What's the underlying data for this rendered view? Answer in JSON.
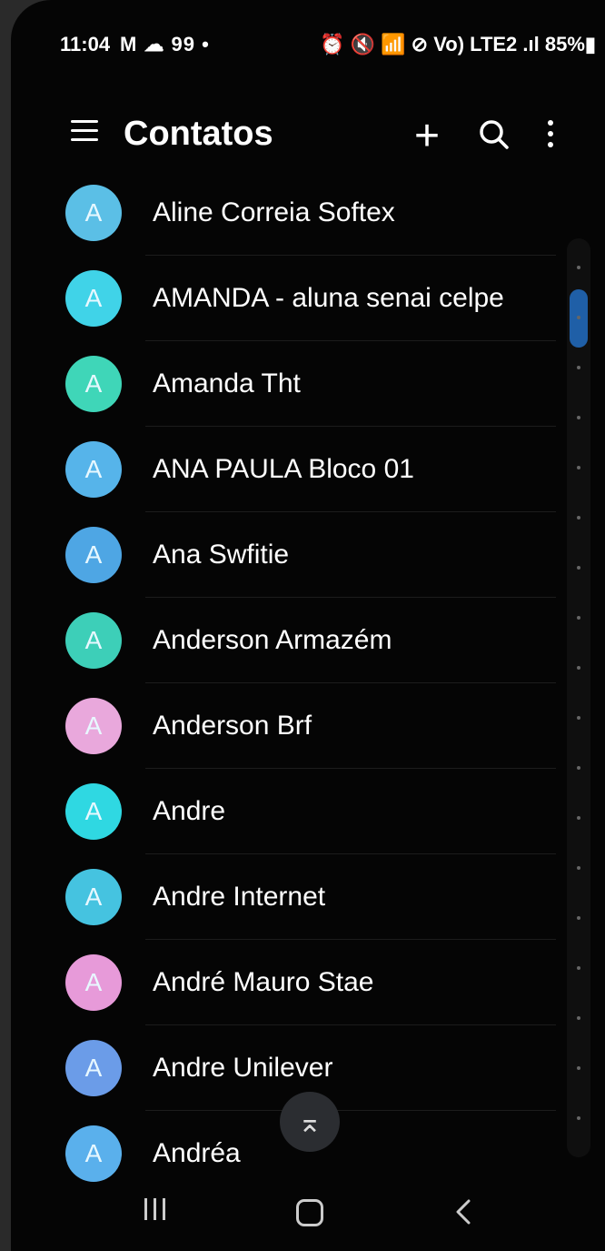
{
  "status_bar": {
    "time": "11:04",
    "notifications": "M ☁ 99 •",
    "right_icons": "⏰ 🔇 📶 ⊘ Vo) LTE2 .ıl 85%▮"
  },
  "app_bar": {
    "title": "Contatos",
    "add_icon": "+"
  },
  "contacts": [
    {
      "name": "Aline Correia Softex",
      "initial": "A",
      "color": "#5bbfe6"
    },
    {
      "name": "AMANDA - aluna senai celpe",
      "initial": "A",
      "color": "#40d3e8"
    },
    {
      "name": "Amanda Tht",
      "initial": "A",
      "color": "#3fd6b8"
    },
    {
      "name": "ANA PAULA Bloco 01",
      "initial": "A",
      "color": "#56b4ea"
    },
    {
      "name": "Ana Swfitie",
      "initial": "A",
      "color": "#4ea6e4"
    },
    {
      "name": "Anderson Armazém",
      "initial": "A",
      "color": "#3dcfb8"
    },
    {
      "name": "Anderson Brf",
      "initial": "A",
      "color": "#e9a8dc"
    },
    {
      "name": "Andre",
      "initial": "A",
      "color": "#2fd8e2"
    },
    {
      "name": "Andre Internet",
      "initial": "A",
      "color": "#45c3e0"
    },
    {
      "name": "André Mauro Stae",
      "initial": "A",
      "color": "#e79ad9"
    },
    {
      "name": "Andre Unilever",
      "initial": "A",
      "color": "#6b9ce8"
    },
    {
      "name": "Andréa",
      "initial": "A",
      "color": "#5ab0ec"
    }
  ],
  "scroll_top_icon": "⌅"
}
